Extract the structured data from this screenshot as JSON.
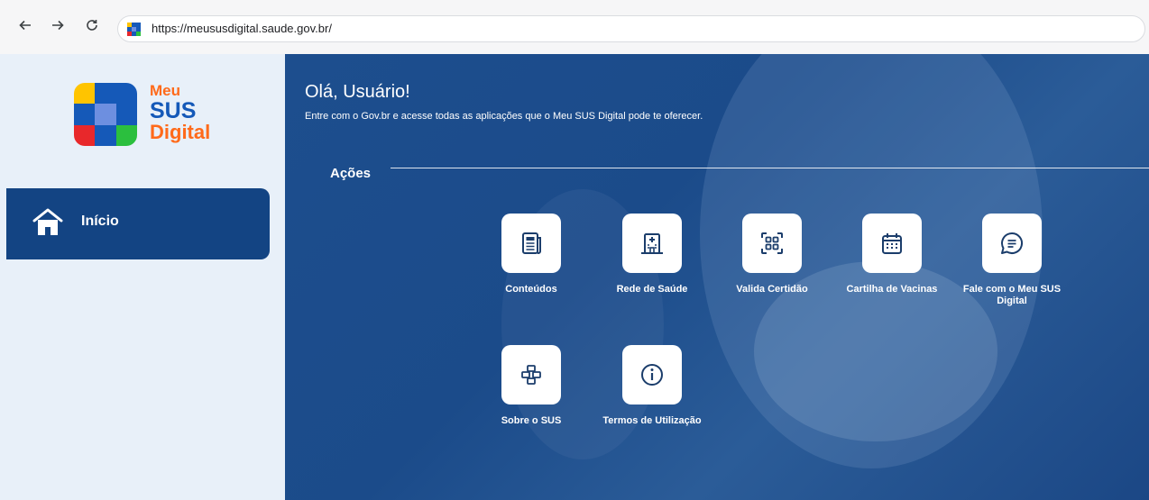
{
  "browser": {
    "url": "https://meususdigital.saude.gov.br/"
  },
  "logo": {
    "line1": "Meu",
    "line2": "SUS",
    "line3": "Digital"
  },
  "sidebar": {
    "items": [
      {
        "label": "Início",
        "icon": "home-icon"
      }
    ]
  },
  "main": {
    "greeting": "Olá, Usuário!",
    "subtitle": "Entre com o Gov.br e acesse todas as aplicações que o Meu SUS Digital pode te oferecer.",
    "section_title": "Ações",
    "actions": [
      {
        "label": "Conteúdos",
        "icon": "newspaper-icon"
      },
      {
        "label": "Rede de Saúde",
        "icon": "hospital-icon"
      },
      {
        "label": "Valida Certidão",
        "icon": "qr-scan-icon"
      },
      {
        "label": "Cartilha de Vacinas",
        "icon": "calendar-icon"
      },
      {
        "label": "Fale com o Meu SUS Digital",
        "icon": "chat-icon"
      },
      {
        "label": "Sobre o SUS",
        "icon": "sus-cross-icon"
      },
      {
        "label": "Termos de Utilização",
        "icon": "info-icon"
      }
    ]
  },
  "colors": {
    "primary": "#134483",
    "orange": "#ff6a1a",
    "blue": "#1559b8",
    "sidebar_bg": "#e8f0f9"
  }
}
